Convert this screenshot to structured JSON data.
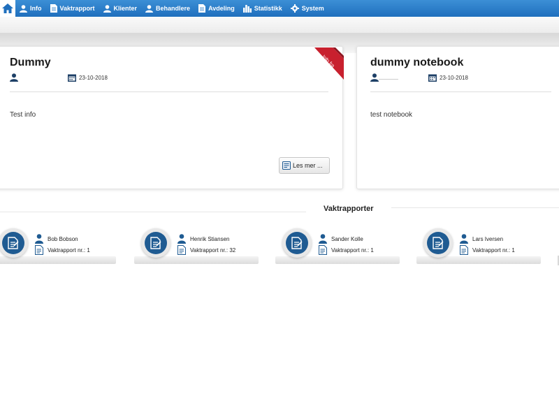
{
  "nav": {
    "items": [
      {
        "label": "Info",
        "icon": "user-icon"
      },
      {
        "label": "Vaktrapport",
        "icon": "document-icon"
      },
      {
        "label": "Klienter",
        "icon": "user-icon"
      },
      {
        "label": "Behandlere",
        "icon": "user-icon"
      },
      {
        "label": "Avdeling",
        "icon": "document-icon"
      },
      {
        "label": "Statistikk",
        "icon": "bar-chart-icon"
      },
      {
        "label": "System",
        "icon": "gear-icon"
      }
    ]
  },
  "cards": [
    {
      "title": "Dummy",
      "date": "23-10-2018",
      "body": "Test info",
      "button": "Les mer ...",
      "ribbon": "Info fra Ledelsen"
    },
    {
      "title": "dummy notebook",
      "date": "23-10-2018",
      "body": "test notebook"
    }
  ],
  "vaktrapporter": {
    "title": "Vaktrapporter",
    "items": [
      {
        "name": "Bob Bobson",
        "nr": "Vaktrapport nr.: 1"
      },
      {
        "name": "Henrik Stiansen",
        "nr": "Vaktrapport nr.: 32"
      },
      {
        "name": "Sander Kolle",
        "nr": "Vaktrapport nr.: 1"
      },
      {
        "name": "Lars Iversen",
        "nr": "Vaktrapport nr.: 1"
      }
    ]
  },
  "colors": {
    "nav": "#1f6fbd",
    "ribbon": "#c8202e",
    "icon": "#1f5b92"
  }
}
